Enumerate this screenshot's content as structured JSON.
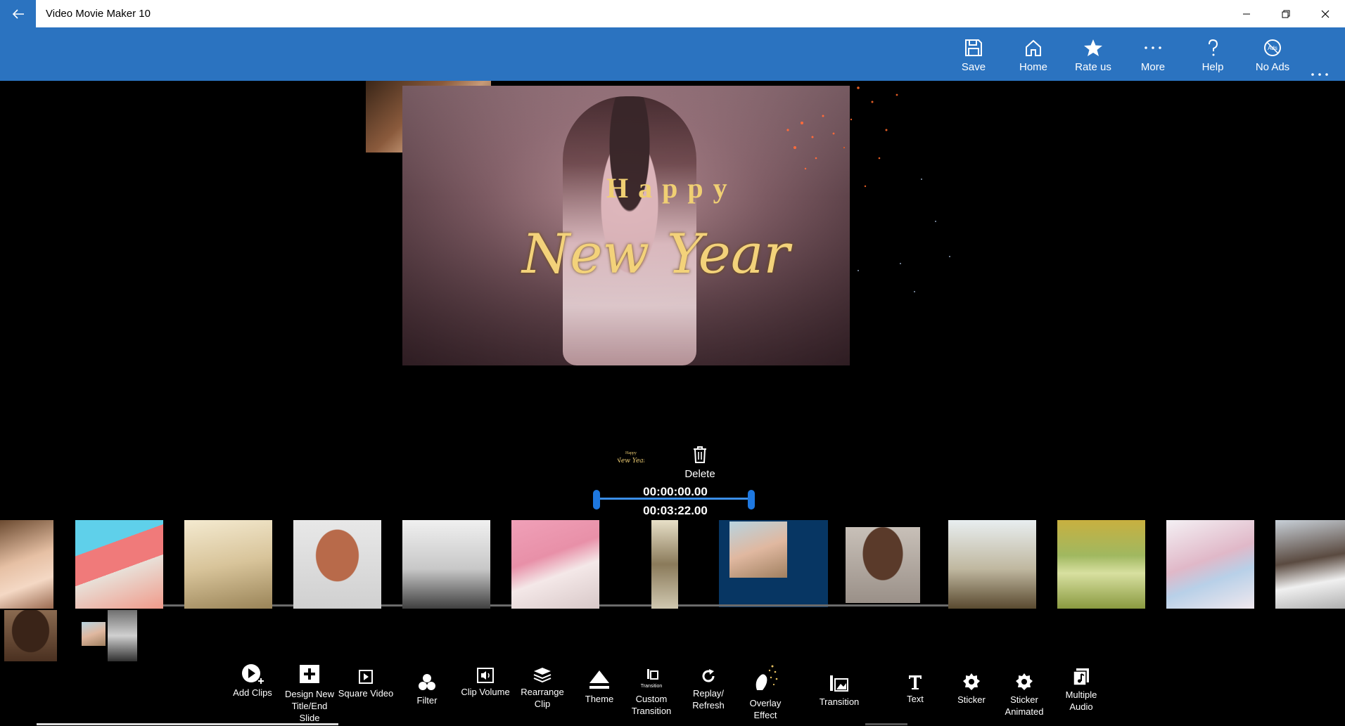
{
  "titlebar": {
    "app_title": "Video Movie Maker 10"
  },
  "cmdbar": {
    "items": [
      {
        "label": "Save",
        "icon": "save-icon"
      },
      {
        "label": "Home",
        "icon": "home-icon"
      },
      {
        "label": "Rate us",
        "icon": "star-icon"
      },
      {
        "label": "More",
        "icon": "ellipsis-icon"
      },
      {
        "label": "Help",
        "icon": "question-icon"
      },
      {
        "label": "No Ads",
        "icon": "no-ads-icon"
      }
    ]
  },
  "preview": {
    "title_line1": "Happy",
    "title_line2": "New Year"
  },
  "selection": {
    "delete_label": "Delete",
    "start_time": "00:00:00.00",
    "end_time": "00:03:22.00"
  },
  "toolbar": {
    "items": [
      {
        "label": "Add Clips",
        "icon": "add-clips-icon"
      },
      {
        "label": "Design New Title/End Slide",
        "icon": "design-slide-icon"
      },
      {
        "label": "Square Video",
        "icon": "square-video-icon"
      },
      {
        "label": "Filter",
        "icon": "filter-icon"
      },
      {
        "label": "Clip Volume",
        "icon": "volume-icon"
      },
      {
        "label": "Rearrange Clip",
        "icon": "rearrange-icon"
      },
      {
        "label": "Theme",
        "icon": "theme-icon"
      },
      {
        "label": "Custom Transition",
        "icon": "custom-transition-icon",
        "icon_text": "Transition"
      },
      {
        "label": "Replay/ Refresh",
        "icon": "refresh-icon"
      },
      {
        "label": "Overlay Effect",
        "icon": "overlay-effect-icon"
      },
      {
        "label": "Transition",
        "icon": "transition-icon"
      },
      {
        "label": "Text",
        "icon": "text-icon"
      },
      {
        "label": "Sticker",
        "icon": "sticker-icon"
      },
      {
        "label": "Sticker Animated",
        "icon": "sticker-animated-icon"
      },
      {
        "label": "Multiple Audio",
        "icon": "multiple-audio-icon"
      }
    ]
  },
  "colors": {
    "accent": "#2b73c0",
    "selected_clip": "#073663",
    "trim": "#1e78e0"
  }
}
